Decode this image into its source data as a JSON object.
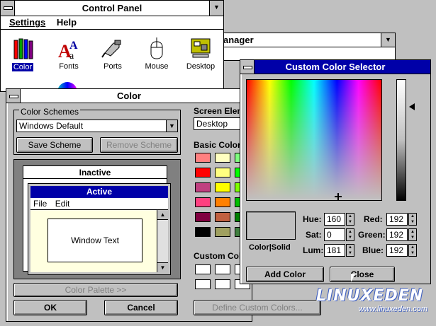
{
  "control_panel": {
    "title": "Control Panel",
    "menu": [
      "Settings",
      "Help"
    ],
    "icons": [
      {
        "label": "Color",
        "icon": "color-crayons-icon"
      },
      {
        "label": "Fonts",
        "icon": "fonts-icon"
      },
      {
        "label": "Ports",
        "icon": "ports-icon"
      },
      {
        "label": "Mouse",
        "icon": "mouse-icon"
      },
      {
        "label": "Desktop",
        "icon": "desktop-icon"
      }
    ]
  },
  "background_window": {
    "title_fragment": "anager"
  },
  "color_dialog": {
    "title": "Color",
    "schemes_label": "Color Schemes",
    "scheme_value": "Windows Default",
    "save_scheme": "Save Scheme",
    "remove_scheme": "Remove Scheme",
    "preview": {
      "inactive_title": "Inactive",
      "active_title": "Active",
      "menu_file": "File",
      "menu_edit": "Edit",
      "window_text": "Window Text"
    },
    "color_palette": "Color Palette >>",
    "ok": "OK",
    "cancel": "Cancel",
    "screen_element_label": "Screen Elem",
    "screen_element_value": "Desktop",
    "basic_colors_label": "Basic Colors",
    "custom_colors_label": "Custom Colo",
    "define_custom": "Define Custom Colors...",
    "basic_colors": [
      "#ff8080",
      "#ffffc0",
      "#80ff80",
      "#ff0000",
      "#ffff80",
      "#00ff00",
      "#c04080",
      "#ffff00",
      "#80ff00",
      "#ff4080",
      "#ff8000",
      "#00c000",
      "#800040",
      "#c06040",
      "#008000",
      "#000000",
      "#a0a060",
      "#408040"
    ]
  },
  "custom_selector": {
    "title": "Custom Color Selector",
    "color_solid": "Color|Solid",
    "hue_label": "Hue:",
    "hue": "160",
    "sat_label": "Sat:",
    "sat": "0",
    "lum_label": "Lum:",
    "lum": "181",
    "red_label": "Red:",
    "red": "192",
    "green_label": "Green:",
    "green": "192",
    "blue_label": "Blue:",
    "blue": "192",
    "add_color": "Add Color",
    "close": "Close",
    "current_color": "#c0c0c0"
  },
  "watermark": {
    "brand": "LINUXEDEN",
    "url": "www.linuxeden.com"
  }
}
